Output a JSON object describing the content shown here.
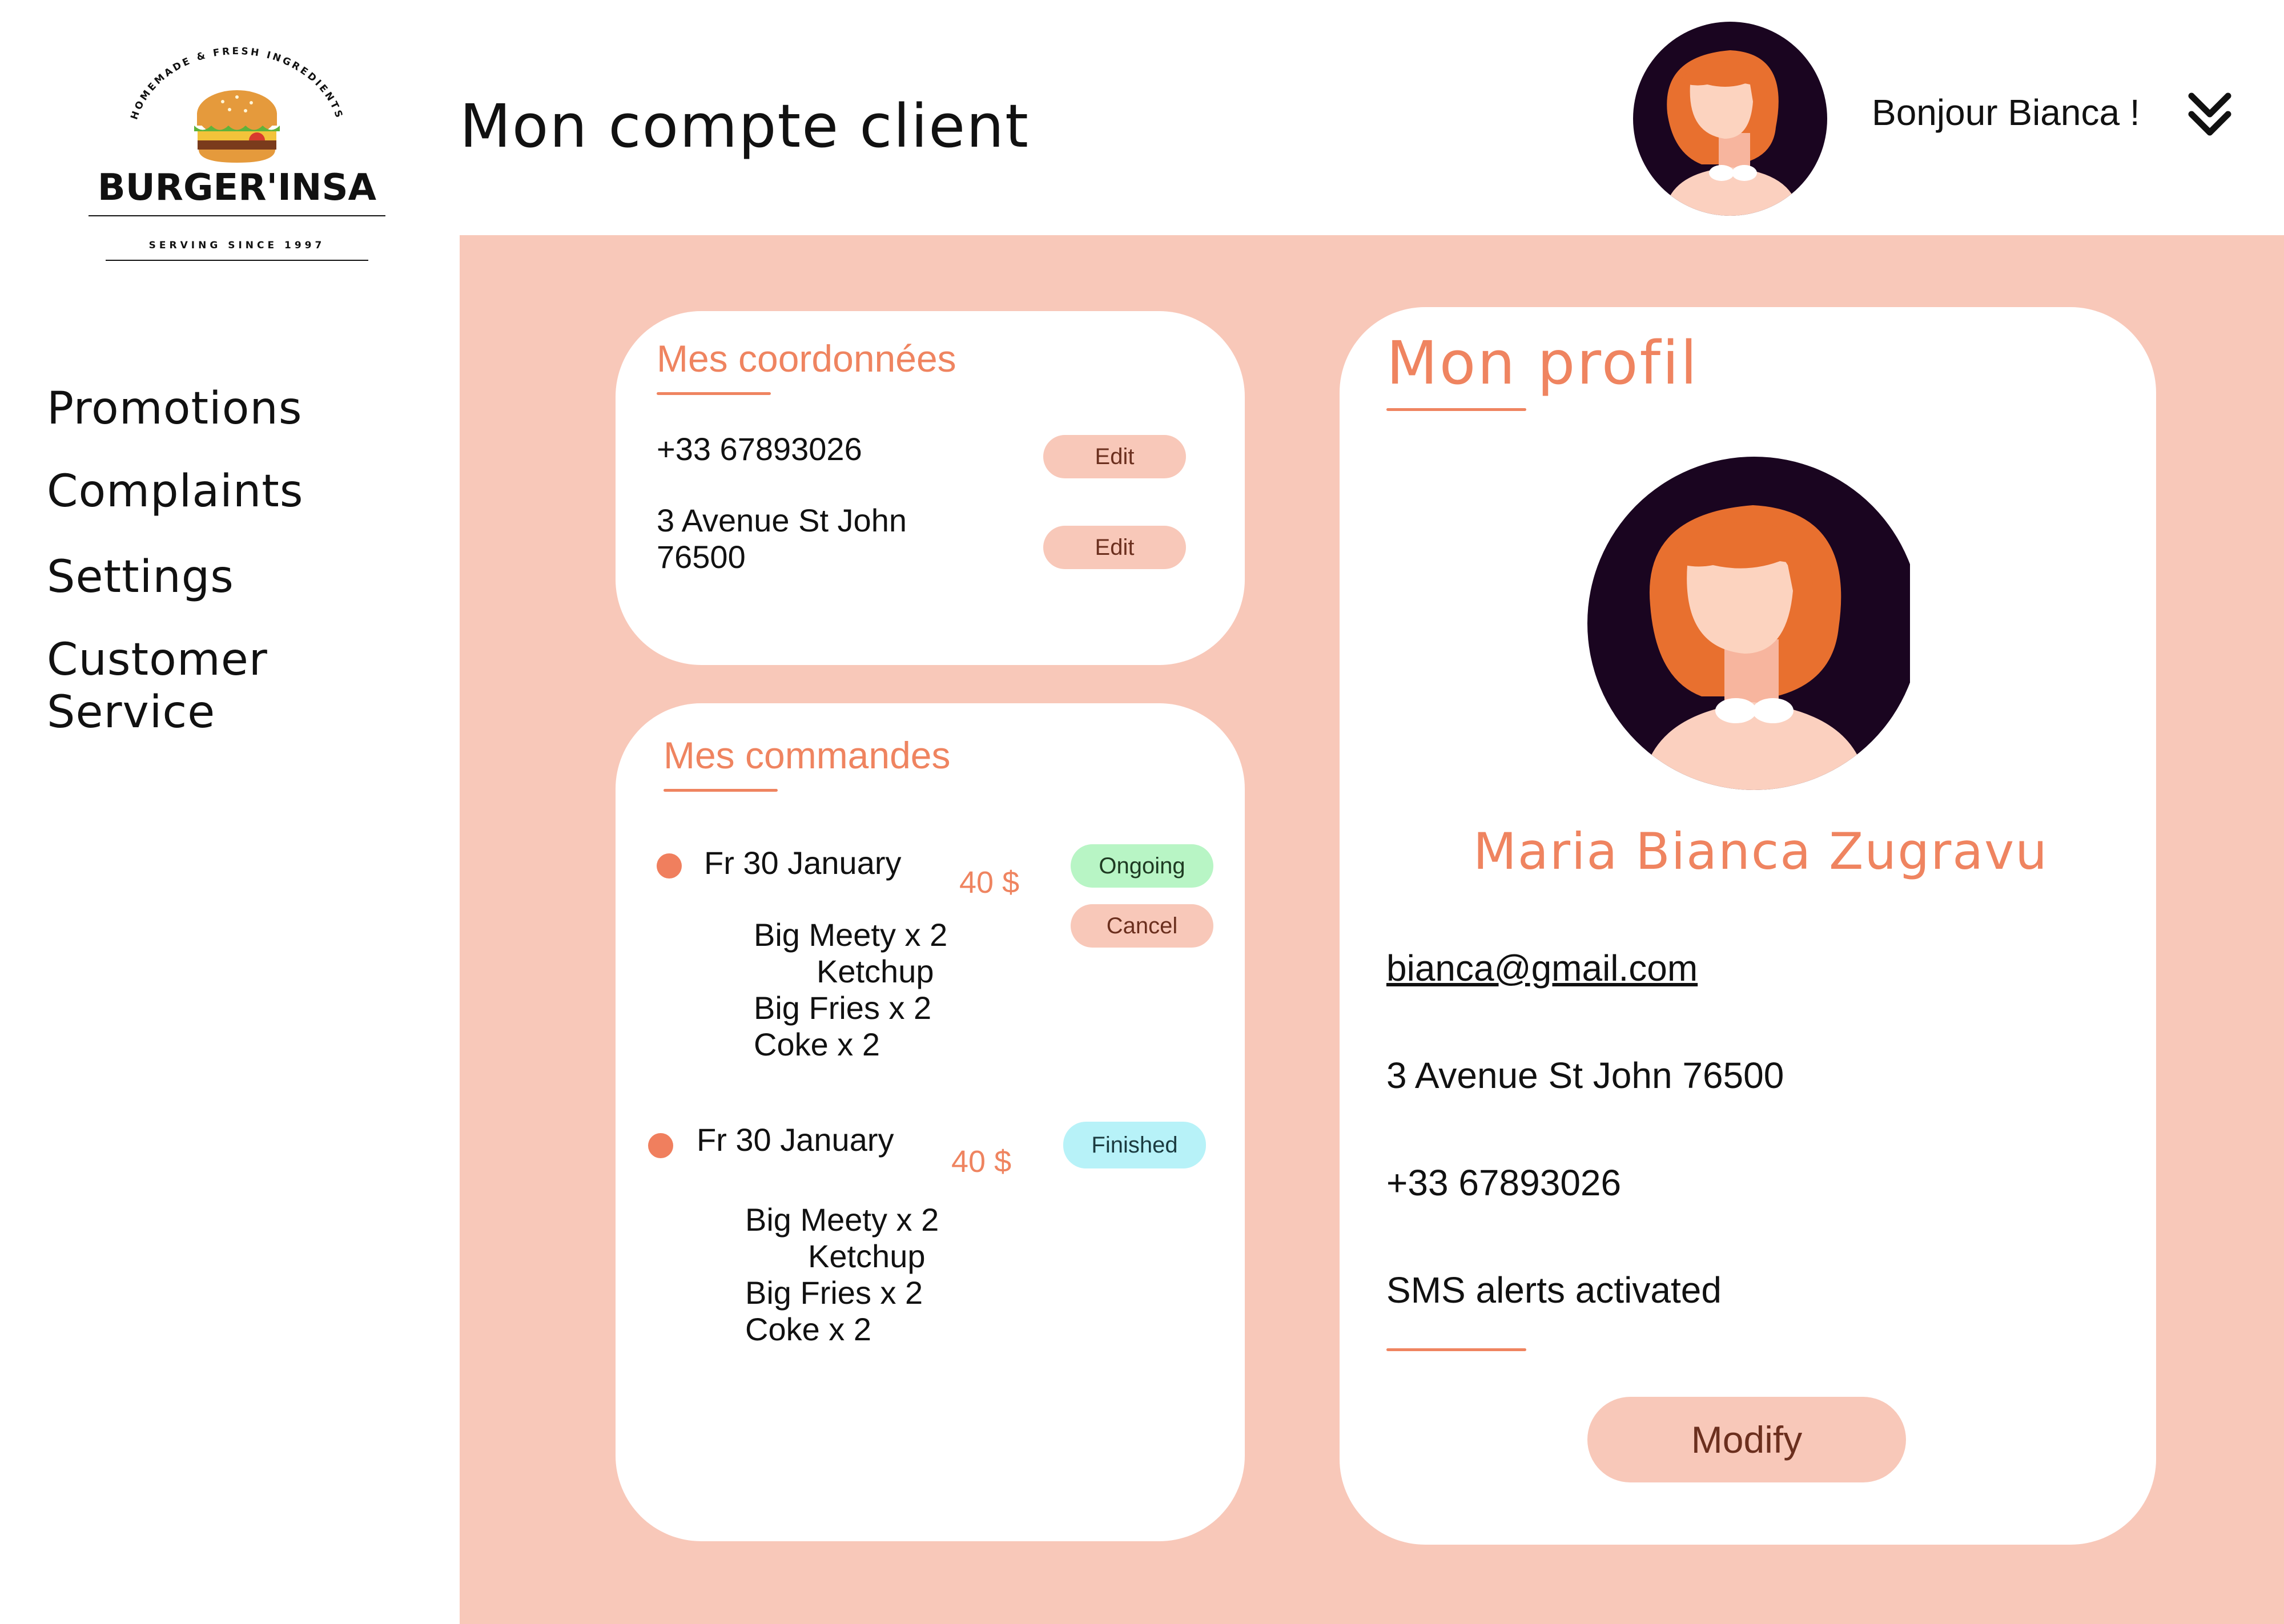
{
  "brand": {
    "arc_text": "HOMEMADE & FRESH INGREDIENTS",
    "name": "BURGER'INSA",
    "tagline": "SERVING SINCE 1997"
  },
  "header": {
    "page_title": "Mon compte client",
    "greeting": "Bonjour Bianca !"
  },
  "sidebar": {
    "items": [
      {
        "label": "Promotions"
      },
      {
        "label": "Complaints"
      },
      {
        "label": "Settings"
      },
      {
        "label": "Customer Service"
      }
    ]
  },
  "coordinates_card": {
    "title": "Mes coordonnées",
    "phone": "+33 67893026",
    "address_line1": "3 Avenue St John",
    "address_line2": "76500",
    "edit_label": "Edit"
  },
  "orders_card": {
    "title": "Mes commandes",
    "orders": [
      {
        "date": "Fr 30 January",
        "price": "40 $",
        "status": "Ongoing",
        "action": "Cancel",
        "items": [
          "Big Meety x 2",
          "Ketchup",
          "Big Fries x 2",
          "Coke x 2"
        ]
      },
      {
        "date": "Fr 30 January",
        "price": "40 $",
        "status": "Finished",
        "items": [
          "Big Meety x 2",
          "Ketchup",
          "Big Fries x 2",
          "Coke x 2"
        ]
      }
    ]
  },
  "profile_card": {
    "title": "Mon profil",
    "name": "Maria Bianca Zugravu",
    "email": "bianca@gmail.com",
    "address": "3 Avenue St John 76500",
    "phone": "+33 67893026",
    "sms": "SMS alerts activated",
    "modify_label": "Modify"
  },
  "icons": {
    "header_avatar": "avatar-icon",
    "menu_toggle": "double-chevron-down-icon",
    "status_dot": "status-dot-icon"
  },
  "colors": {
    "accent": "#ef8460",
    "panel_background": "#f8c8b9",
    "ongoing_badge": "#b8f5c5",
    "finished_badge": "#b7f2f8",
    "avatar_background": "#1a0520",
    "hair": "#e8702f"
  }
}
